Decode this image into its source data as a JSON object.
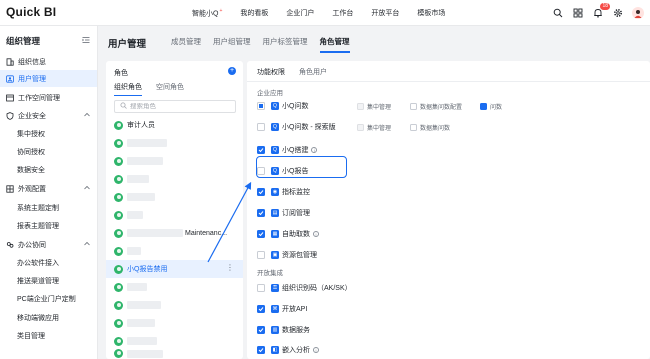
{
  "app": {
    "logo": "Quick BI"
  },
  "topnav": [
    {
      "label": "智能小Q",
      "sup": "+"
    },
    {
      "label": "我的看板"
    },
    {
      "label": "企业门户"
    },
    {
      "label": "工作台"
    },
    {
      "label": "开放平台"
    },
    {
      "label": "模板市场"
    }
  ],
  "topbar": {
    "notification_count": "18",
    "icons": [
      "search-icon",
      "grid-icon",
      "bell-icon",
      "gear-icon",
      "avatar"
    ]
  },
  "sidebar": {
    "title": "组织管理",
    "items": [
      {
        "label": "组织信息",
        "icon": "building-icon",
        "type": "top"
      },
      {
        "label": "用户管理",
        "icon": "user-icon",
        "type": "top",
        "active": true
      },
      {
        "label": "工作空间管理",
        "icon": "workspace-icon",
        "type": "top"
      },
      {
        "label": "企业安全",
        "icon": "shield-icon",
        "type": "group",
        "expanded": true
      },
      {
        "label": "集中授权",
        "type": "sub"
      },
      {
        "label": "协同授权",
        "type": "sub"
      },
      {
        "label": "数据安全",
        "type": "sub"
      },
      {
        "label": "外观配置",
        "icon": "palette-icon",
        "type": "group",
        "expanded": true
      },
      {
        "label": "系统主题定制",
        "type": "sub"
      },
      {
        "label": "报表主题管理",
        "type": "sub"
      },
      {
        "label": "办公协同",
        "icon": "cooperation-icon",
        "type": "group",
        "expanded": true
      },
      {
        "label": "办公软件接入",
        "type": "sub"
      },
      {
        "label": "推送渠道管理",
        "type": "sub"
      },
      {
        "label": "PC端企业门户定制",
        "type": "sub"
      },
      {
        "label": "移动端微应用",
        "type": "sub"
      },
      {
        "label": "类目管理",
        "type": "sub"
      }
    ]
  },
  "main": {
    "page_title": "用户管理",
    "tabs": [
      {
        "label": "成员管理"
      },
      {
        "label": "用户组管理"
      },
      {
        "label": "用户标签管理"
      },
      {
        "label": "角色管理",
        "active": true
      }
    ]
  },
  "role_panel": {
    "title": "角色",
    "tabs": [
      {
        "label": "组织角色",
        "active": true
      },
      {
        "label": "空间角色"
      }
    ],
    "search_placeholder": "搜索角色",
    "roles": [
      {
        "label": "审计人员",
        "blurred": false
      },
      {
        "label": "",
        "blurred": true,
        "blur_w": 40
      },
      {
        "label": "",
        "blurred": true,
        "blur_w": 36
      },
      {
        "label": "",
        "blurred": true,
        "blur_w": 22
      },
      {
        "label": "",
        "blurred": true,
        "blur_w": 28
      },
      {
        "label": "",
        "blurred": true,
        "blur_w": 16
      },
      {
        "label": "Maintenanc...",
        "blurred": true,
        "blur_w": 56,
        "prefix": "x"
      },
      {
        "label": "",
        "blurred": true,
        "blur_w": 14
      },
      {
        "label": "小Q报告禁用",
        "blurred": false,
        "selected": true
      },
      {
        "label": "",
        "blurred": true,
        "blur_w": 20
      },
      {
        "label": "",
        "blurred": true,
        "blur_w": 34
      },
      {
        "label": "",
        "blurred": true,
        "blur_w": 28
      },
      {
        "label": "",
        "blurred": true,
        "blur_w": 30
      },
      {
        "label": "",
        "blurred": true,
        "blur_w": 36
      }
    ]
  },
  "perm_panel": {
    "tabs": [
      {
        "label": "功能权限",
        "active": true
      },
      {
        "label": "角色用户"
      }
    ],
    "section_enterprise": "企业应用",
    "section_open": "开放集成",
    "rows": [
      {
        "label": "小Q问数",
        "state": "partial",
        "icon": "chat-icon",
        "info": false,
        "subs": [
          {
            "label": "集中管理",
            "state": "disabled"
          },
          {
            "label": "数据集问数配置",
            "state": "unchecked"
          },
          {
            "label": "问数",
            "state": "checked"
          }
        ]
      },
      {
        "label": "小Q问数 - 探索版",
        "state": "unchecked",
        "icon": "explore-icon",
        "info": false,
        "subs": [
          {
            "label": "集中管理",
            "state": "disabled"
          },
          {
            "label": "数据集问数",
            "state": "unchecked"
          }
        ]
      },
      {
        "label": "小Q搭建",
        "state": "checked",
        "icon": "build-icon",
        "info": true,
        "subs": []
      },
      {
        "label": "小Q报告",
        "state": "unchecked",
        "icon": "report-icon",
        "info": false,
        "subs": []
      },
      {
        "label": "指标监控",
        "state": "checked",
        "icon": "monitor-icon",
        "info": false,
        "subs": []
      },
      {
        "label": "订阅管理",
        "state": "checked",
        "icon": "subscribe-icon",
        "info": false,
        "subs": []
      },
      {
        "label": "自助取数",
        "state": "checked",
        "icon": "fetch-icon",
        "info": true,
        "subs": []
      },
      {
        "label": "资源包管理",
        "state": "unchecked",
        "icon": "package-icon",
        "info": false,
        "subs": []
      },
      {
        "label": "组织识别码（AK/SK）",
        "state": "unchecked",
        "icon": "key-icon",
        "info": false,
        "subs": []
      },
      {
        "label": "开放API",
        "state": "checked",
        "icon": "api-icon",
        "info": false,
        "subs": []
      },
      {
        "label": "数据服务",
        "state": "checked",
        "icon": "data-service-icon",
        "info": false,
        "subs": []
      },
      {
        "label": "嵌入分析",
        "state": "checked",
        "icon": "embed-icon",
        "info": true,
        "subs": []
      }
    ]
  },
  "colors": {
    "accent": "#1a6cf0",
    "role_icon": "#2fb56b",
    "active_bg": "#e8f1ff"
  }
}
